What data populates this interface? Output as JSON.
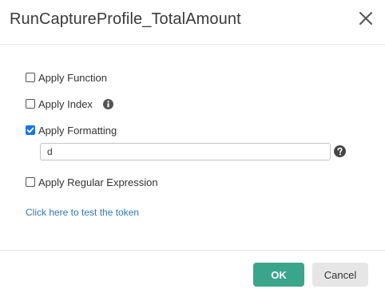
{
  "dialog": {
    "title": "RunCaptureProfile_TotalAmount",
    "close_icon": "close-icon"
  },
  "options": {
    "apply_function": {
      "label": "Apply Function",
      "checked": false
    },
    "apply_index": {
      "label": "Apply Index",
      "checked": false,
      "icon": "info-icon"
    },
    "apply_formatting": {
      "label": "Apply Formatting",
      "checked": true,
      "value": "d",
      "icon": "help-icon"
    },
    "apply_regex": {
      "label": "Apply Regular Expression",
      "checked": false
    }
  },
  "test_link": "Click here to test the token",
  "buttons": {
    "ok_label": "OK",
    "cancel_label": "Cancel"
  },
  "colors": {
    "checkbox_checked": "#1a73e8",
    "ok_button": "#3aa58a",
    "cancel_button": "#e6e6e6",
    "link": "#2f77b5"
  }
}
